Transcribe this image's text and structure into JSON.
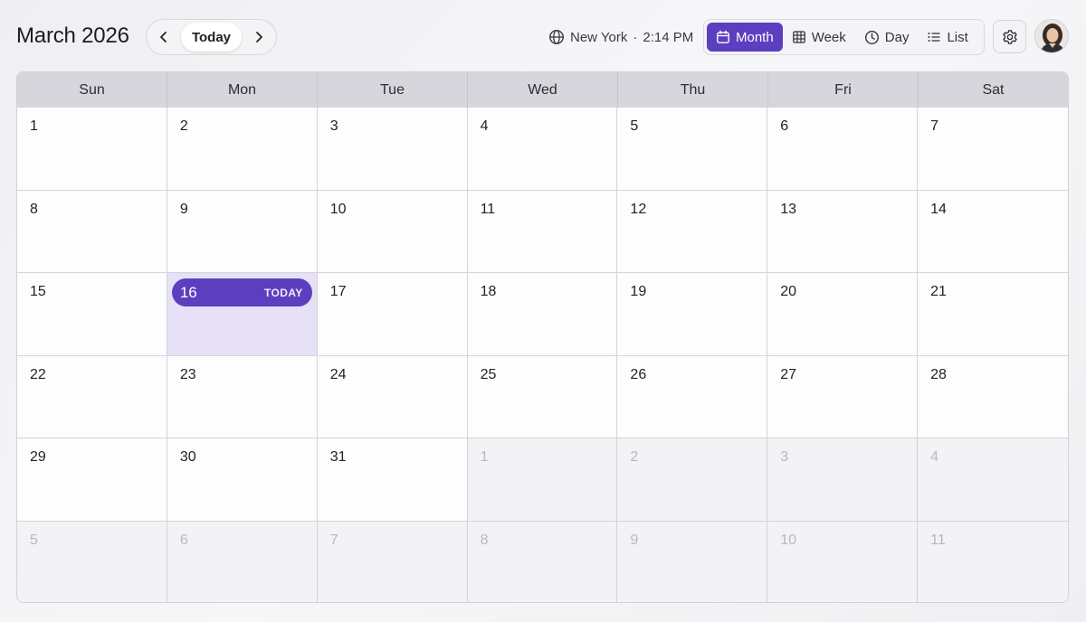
{
  "header": {
    "title": "March 2026",
    "today_label": "Today",
    "timezone": "New York",
    "separator": "·",
    "time": "2:14 PM"
  },
  "views": [
    {
      "label": "Month",
      "icon": "calendar-icon",
      "active": true
    },
    {
      "label": "Week",
      "icon": "grid-icon",
      "active": false
    },
    {
      "label": "Day",
      "icon": "clock-icon",
      "active": false
    },
    {
      "label": "List",
      "icon": "list-icon",
      "active": false
    }
  ],
  "weekdays": [
    "Sun",
    "Mon",
    "Tue",
    "Wed",
    "Thu",
    "Fri",
    "Sat"
  ],
  "weeks": [
    [
      {
        "d": "1"
      },
      {
        "d": "2"
      },
      {
        "d": "3"
      },
      {
        "d": "4"
      },
      {
        "d": "5"
      },
      {
        "d": "6"
      },
      {
        "d": "7"
      }
    ],
    [
      {
        "d": "8"
      },
      {
        "d": "9"
      },
      {
        "d": "10"
      },
      {
        "d": "11"
      },
      {
        "d": "12"
      },
      {
        "d": "13"
      },
      {
        "d": "14"
      }
    ],
    [
      {
        "d": "15"
      },
      {
        "d": "16",
        "today": true
      },
      {
        "d": "17"
      },
      {
        "d": "18"
      },
      {
        "d": "19"
      },
      {
        "d": "20"
      },
      {
        "d": "21"
      }
    ],
    [
      {
        "d": "22"
      },
      {
        "d": "23"
      },
      {
        "d": "24"
      },
      {
        "d": "25"
      },
      {
        "d": "26"
      },
      {
        "d": "27"
      },
      {
        "d": "28"
      }
    ],
    [
      {
        "d": "29"
      },
      {
        "d": "30"
      },
      {
        "d": "31"
      },
      {
        "d": "1",
        "muted": true
      },
      {
        "d": "2",
        "muted": true
      },
      {
        "d": "3",
        "muted": true
      },
      {
        "d": "4",
        "muted": true
      }
    ],
    [
      {
        "d": "5",
        "muted": true
      },
      {
        "d": "6",
        "muted": true
      },
      {
        "d": "7",
        "muted": true
      },
      {
        "d": "8",
        "muted": true
      },
      {
        "d": "9",
        "muted": true
      },
      {
        "d": "10",
        "muted": true
      },
      {
        "d": "11",
        "muted": true
      }
    ]
  ],
  "today_badge": "TODAY",
  "colors": {
    "accent": "#5b3fbf",
    "today_bg": "#e6e1f6",
    "header_bg": "#d6d6dc"
  }
}
